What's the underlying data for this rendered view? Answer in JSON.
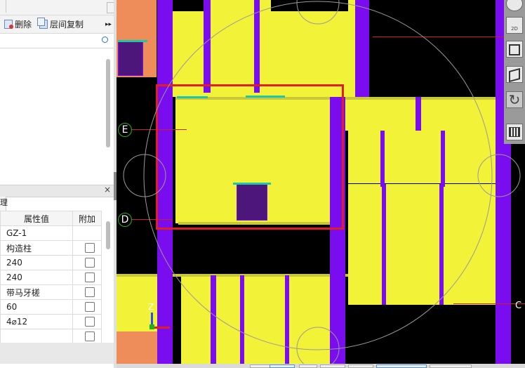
{
  "toolbar": {
    "delete_label": "删除",
    "floor_copy_label": "层间复制",
    "more_label": "▸▸"
  },
  "search": {
    "placeholder": ""
  },
  "properties": {
    "header_left": "理",
    "col_value": "属性值",
    "col_extra": "附加",
    "rows": [
      {
        "value": "GZ-1",
        "checkbox": false
      },
      {
        "value": "构造柱",
        "checkbox": true
      },
      {
        "value": "240",
        "checkbox": true
      },
      {
        "value": "240",
        "checkbox": true
      },
      {
        "value": "带马牙槎",
        "checkbox": true
      },
      {
        "value": "60",
        "checkbox": true
      },
      {
        "value": "4⌀12",
        "checkbox": true
      },
      {
        "value": "",
        "checkbox": true
      }
    ]
  },
  "canvas": {
    "axis_labels": [
      "E",
      "D"
    ],
    "axis_right_label": "C",
    "axis_z_label": "Z",
    "colors": {
      "slab": "#f2f238",
      "column": "#7a0cf0",
      "selection": "#e02020",
      "cap": "#1fc7a9"
    }
  },
  "view_tools": {
    "btn_2d": "2D"
  },
  "panel_close": "×"
}
